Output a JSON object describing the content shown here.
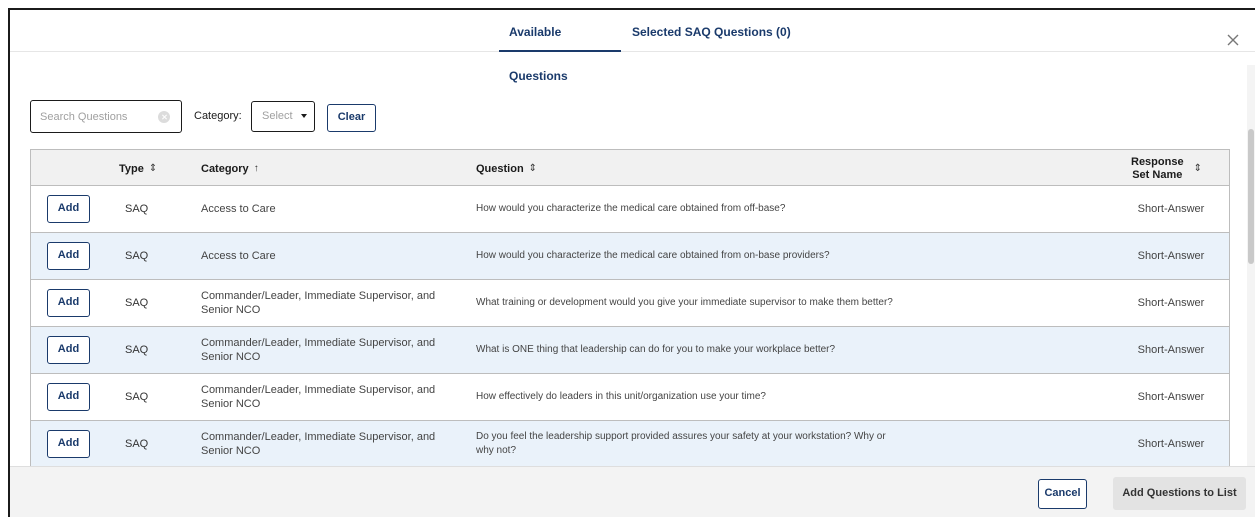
{
  "tabs": [
    {
      "label": "Available Questions",
      "active": true
    },
    {
      "label": "Selected SAQ Questions (0)",
      "active": false
    }
  ],
  "filters": {
    "search_placeholder": "Search Questions",
    "search_value": "",
    "category_label": "Category:",
    "category_selected": "Select",
    "clear_label": "Clear"
  },
  "table": {
    "headers": {
      "type": "Type",
      "category": "Category",
      "question": "Question",
      "response_line1": "Response",
      "response_line2": "Set Name"
    },
    "sort_icons": {
      "type": "sort-both-icon",
      "category": "sort-ascending-icon",
      "question": "sort-both-icon",
      "response": "sort-both-icon"
    },
    "add_label": "Add",
    "rows": [
      {
        "type": "SAQ",
        "category": "Access to Care",
        "question": "How would you characterize the medical care obtained from off-base?",
        "response": "Short-Answer"
      },
      {
        "type": "SAQ",
        "category": "Access to Care",
        "question": "How would you characterize the medical care obtained from on-base providers?",
        "response": "Short-Answer"
      },
      {
        "type": "SAQ",
        "category": "Commander/Leader, Immediate Supervisor, and Senior NCO",
        "question": "What training or development would you give your immediate supervisor to make them better?",
        "response": "Short-Answer"
      },
      {
        "type": "SAQ",
        "category": "Commander/Leader, Immediate Supervisor, and Senior NCO",
        "question": "What is ONE thing that leadership can do for you to make your workplace better?",
        "response": "Short-Answer"
      },
      {
        "type": "SAQ",
        "category": "Commander/Leader, Immediate Supervisor, and Senior NCO",
        "question": "How effectively do leaders in this unit/organization use your time?",
        "response": "Short-Answer"
      },
      {
        "type": "SAQ",
        "category": "Commander/Leader, Immediate Supervisor, and Senior NCO",
        "question": "Do you feel the leadership support provided assures your safety at your workstation? Why or why not?",
        "response": "Short-Answer"
      }
    ]
  },
  "footer": {
    "cancel_label": "Cancel",
    "add_questions_label": "Add Questions to List"
  },
  "colors": {
    "accent": "#1a3a6b",
    "row_alt": "#eaf2fa",
    "header_bg": "#f1f1f1",
    "footer_bg": "#f3f3f3"
  }
}
